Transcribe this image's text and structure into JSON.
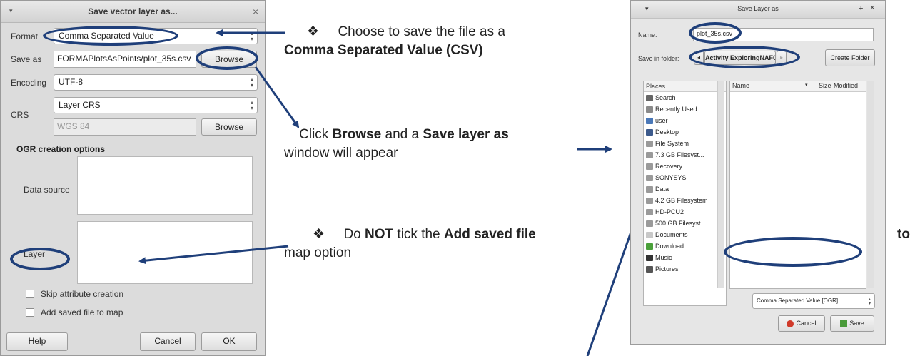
{
  "left_dialog": {
    "title": "Save vector layer as...",
    "close_glyph": "×",
    "menu_glyph": "▾",
    "format_label": "Format",
    "format_value": "Comma Separated Value",
    "save_as_label": "Save as",
    "save_as_value": "FORMAPlotsAsPoints/plot_35s.csv",
    "browse_label": "Browse",
    "encoding_label": "Encoding",
    "encoding_value": "UTF-8",
    "crs_label": "CRS",
    "crs_mode_value": "Layer CRS",
    "crs_value": "WGS 84",
    "ogr_heading": "OGR creation options",
    "data_source_label": "Data source",
    "layer_label": "Layer",
    "skip_attr_label": "Skip attribute creation",
    "add_saved_label": "Add saved file to map",
    "help_label": "Help",
    "cancel_label": "Cancel",
    "ok_label": "OK"
  },
  "annotations": {
    "bullet": "❖",
    "a1_line1": "Choose to save the file as a",
    "a1_line2": "Comma Separated Value (CSV)",
    "a2_pre": "Click ",
    "a2_browse": "Browse",
    "a2_mid": " and a ",
    "a2_window": "Save layer as",
    "a2_line2": "window will appear",
    "a3_pre": "Do ",
    "a3_not": "NOT",
    "a3_mid": " tick the ",
    "a3_add": "Add saved file",
    "a3_to": "to",
    "a3_line2": "map option"
  },
  "right_dialog": {
    "title": "Save Layer as",
    "pin_glyph": "+",
    "close_glyph": "×",
    "menu_glyph": "▾",
    "name_label": "Name:",
    "name_value": "plot_35s.csv",
    "save_in_label": "Save in folder:",
    "path_prev": "◂",
    "path_current": "Activity ExploringNAFO",
    "path_next": "▸",
    "create_folder_label": "Create Folder",
    "places_header": "Places",
    "name_col": "Name",
    "size_col": "Size",
    "modified_col": "Modified",
    "places": [
      {
        "label": "Search",
        "icon": "search-icon"
      },
      {
        "label": "Recently Used",
        "icon": "recent-icon"
      },
      {
        "label": "user",
        "icon": "home-icon"
      },
      {
        "label": "Desktop",
        "icon": "desktop-icon"
      },
      {
        "label": "File System",
        "icon": "drive-icon"
      },
      {
        "label": "7.3 GB Filesyst...",
        "icon": "drive-icon"
      },
      {
        "label": "Recovery",
        "icon": "drive-icon"
      },
      {
        "label": "SONYSYS",
        "icon": "drive-icon"
      },
      {
        "label": "Data",
        "icon": "drive-icon"
      },
      {
        "label": "4.2 GB Filesystem",
        "icon": "drive-icon"
      },
      {
        "label": "HD-PCU2",
        "icon": "drive-icon"
      },
      {
        "label": "500 GB Filesyst...",
        "icon": "drive-icon"
      },
      {
        "label": "Documents",
        "icon": "folder-icon"
      },
      {
        "label": "Download",
        "icon": "download-icon"
      },
      {
        "label": "Music",
        "icon": "music-icon"
      },
      {
        "label": "Pictures",
        "icon": "pictures-icon"
      }
    ],
    "filter_value": "Comma Separated Value [OGR]",
    "cancel_label": "Cancel",
    "save_label": "Save"
  },
  "colors": {
    "highlight": "#1f3f7a",
    "cancel_icon": "#d03a2a",
    "save_icon": "#4a9a3a"
  }
}
